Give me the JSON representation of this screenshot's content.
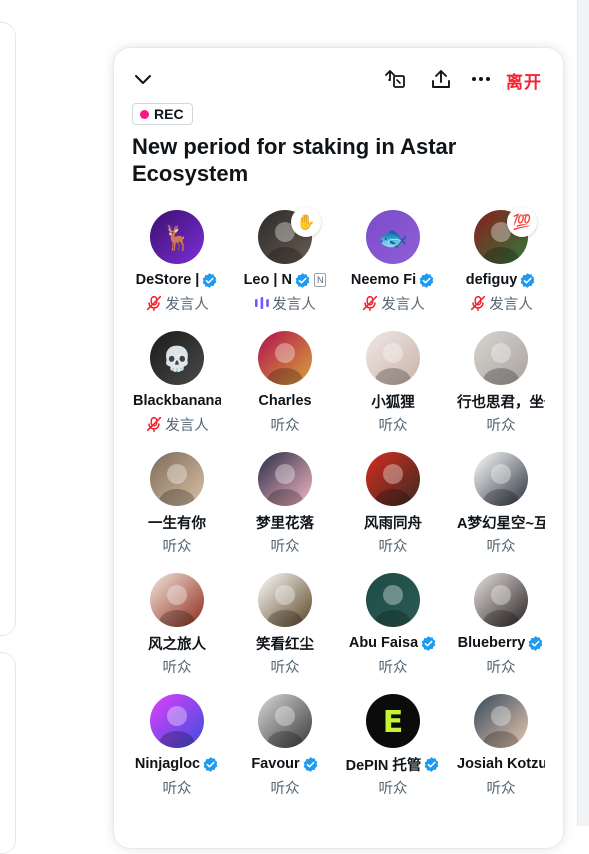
{
  "space": {
    "title": "New period for staking in Astar Ecosystem",
    "rec_label": "REC",
    "leave_label": "离开"
  },
  "icons": {
    "collapse": "chevron-down-icon",
    "share": "share-space-icon",
    "upload": "upload-icon",
    "more": "more-horizontal-icon",
    "verified": "verified-badge-icon",
    "muted": "mic-muted-icon",
    "speaking": "speaking-bars-icon"
  },
  "colors": {
    "accent_red": "#f4212e",
    "rec_dot": "#f91880",
    "verified_blue": "#1d9bf0",
    "speaking_purple": "#7856ff",
    "muted_red": "#f4212e",
    "secondary_text": "#536471"
  },
  "participants": [
    {
      "name": "DeStore | ",
      "role": "发言人",
      "verified": true,
      "status": "muted",
      "avatar_colors": [
        "#3b0f6e",
        "#7b2fd8"
      ],
      "avatar_glyph": "🦌"
    },
    {
      "name": "Leo | N",
      "role": "发言人",
      "verified": true,
      "status": "speaking",
      "badge": "✋",
      "tag": "N",
      "avatar_colors": [
        "#2b2a28",
        "#6a5c52"
      ],
      "avatar_glyph": ""
    },
    {
      "name": "Neemo Fi",
      "role": "发言人",
      "verified": true,
      "status": "muted",
      "avatar_colors": [
        "#7b4bc9",
        "#8f60d8"
      ],
      "avatar_glyph": "🐟"
    },
    {
      "name": "defiguy",
      "role": "发言人",
      "verified": true,
      "status": "muted",
      "badge": "💯",
      "avatar_colors": [
        "#8a1d1d",
        "#2f7a3a"
      ],
      "avatar_glyph": ""
    },
    {
      "name": "Blackbanana",
      "role": "发言人",
      "verified": false,
      "status": "muted",
      "avatar_colors": [
        "#1a1a1a",
        "#4a4a4a"
      ],
      "avatar_glyph": "💀"
    },
    {
      "name": "Charles",
      "role": "听众",
      "verified": false,
      "status": "listener",
      "avatar_colors": [
        "#b0124f",
        "#d9a23a"
      ],
      "avatar_glyph": ""
    },
    {
      "name": "小狐狸",
      "role": "听众",
      "verified": false,
      "status": "listener",
      "avatar_colors": [
        "#f0e8e6",
        "#c9b2a8"
      ],
      "avatar_glyph": ""
    },
    {
      "name": "行也思君，坐也",
      "role": "听众",
      "verified": false,
      "status": "listener",
      "avatar_colors": [
        "#d8d4d0",
        "#a9a39e"
      ],
      "avatar_glyph": ""
    },
    {
      "name": "一生有你",
      "role": "听众",
      "verified": false,
      "status": "listener",
      "avatar_colors": [
        "#7d6a5a",
        "#d9c1a6"
      ],
      "avatar_glyph": ""
    },
    {
      "name": "梦里花落",
      "role": "听众",
      "verified": false,
      "status": "listener",
      "avatar_colors": [
        "#2a2e46",
        "#f4b6c2"
      ],
      "avatar_glyph": ""
    },
    {
      "name": "风雨同舟",
      "role": "听众",
      "verified": false,
      "status": "listener",
      "avatar_colors": [
        "#d62d1e",
        "#3b2a22"
      ],
      "avatar_glyph": ""
    },
    {
      "name": "A梦幻星空~互",
      "role": "听众",
      "verified": false,
      "status": "listener",
      "avatar_colors": [
        "#ffffff",
        "#2c3440"
      ],
      "avatar_glyph": ""
    },
    {
      "name": "风之旅人",
      "role": "听众",
      "verified": false,
      "status": "listener",
      "avatar_colors": [
        "#f3e7dc",
        "#8d2a1c"
      ],
      "avatar_glyph": ""
    },
    {
      "name": "笑看红尘",
      "role": "听众",
      "verified": false,
      "status": "listener",
      "avatar_colors": [
        "#ffffff",
        "#5a4522"
      ],
      "avatar_glyph": ""
    },
    {
      "name": "Abu Faisa",
      "role": "听众",
      "verified": true,
      "status": "listener",
      "avatar_colors": [
        "#1e4a44",
        "#2b5c55"
      ],
      "avatar_glyph": ""
    },
    {
      "name": "Blueberry",
      "role": "听众",
      "verified": true,
      "status": "listener",
      "avatar_colors": [
        "#e8e2e2",
        "#2a2222"
      ],
      "avatar_glyph": ""
    },
    {
      "name": "Ninjagloc",
      "role": "听众",
      "verified": true,
      "status": "listener",
      "avatar_colors": [
        "#e040fb",
        "#3b4de0"
      ],
      "avatar_glyph": ""
    },
    {
      "name": "Favour",
      "role": "听众",
      "verified": true,
      "status": "listener",
      "avatar_colors": [
        "#d8d8d8",
        "#3a3a3a"
      ],
      "avatar_glyph": ""
    },
    {
      "name": "DePIN 托管",
      "role": "听众",
      "verified": true,
      "status": "listener",
      "avatar_colors": [
        "#0b0b0b",
        "#0b0b0b"
      ],
      "avatar_glyph": "E"
    },
    {
      "name": "Josiah Kotzur",
      "role": "听众",
      "verified": false,
      "status": "listener",
      "avatar_colors": [
        "#35495c",
        "#e8c7b0"
      ],
      "avatar_glyph": ""
    }
  ]
}
